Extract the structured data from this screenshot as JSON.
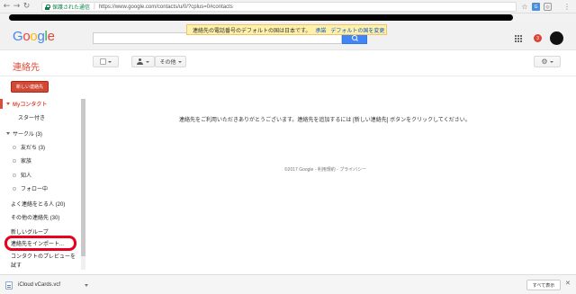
{
  "browser": {
    "back_icon": "←",
    "forward_icon": "→",
    "reload_icon": "↻",
    "secure_label": "保護された通信",
    "separator": "|",
    "url": "https://www.google.com/contacts/u/0/?cplus=0#contacts",
    "star_icon": "☆",
    "menu_icon": "⋮",
    "ext1_label": "G",
    "ext2_label": "◎"
  },
  "google_header": {
    "logo_letters": [
      "G",
      "o",
      "o",
      "g",
      "l",
      "e"
    ],
    "notice_text": "連絡先の電話番号のデフォルトの国は日本です。",
    "notice_ok_link": "承諾",
    "notice_change_link": "デフォルトの国を変更",
    "notification_count": "3"
  },
  "toolbar": {
    "app_title": "連絡先",
    "more_label": "その他",
    "settings_icon": "⚙"
  },
  "sidebar": {
    "new_contact_button": "新しい連絡先",
    "my_contacts": "Myコンタクト",
    "starred": "スター付き",
    "circles": "サークル (3)",
    "friends": "友だち (3)",
    "family": "家族",
    "acquaintances": "知人",
    "following": "フォロー中",
    "most_contacted": "よく連絡をとる人 (20)",
    "other_contacts": "その他の連絡先 (30)",
    "new_group": "新しいグループ",
    "import_contacts": "連絡先をインポート...",
    "preview_line1": "コンタクトのプレビューを",
    "preview_line2": "試す"
  },
  "main": {
    "empty_message": "連絡先をご利用いただきありがとうございます。連絡先を追加するには [新しい連絡先] ボタンをクリックしてください。",
    "footer_copyright": "©2017 Google - ",
    "footer_terms": "利用規約",
    "footer_sep": " - ",
    "footer_privacy": "プライバシー"
  },
  "download_bar": {
    "file_name": "iCloud vCards.vcf",
    "show_all_button": "すべて表示",
    "close_icon": "✕"
  },
  "colors": {
    "google_blue": "#4285f4",
    "contacts_red": "#dd4b39",
    "new_button_red": "#d14836",
    "highlight_red": "#e8001c",
    "notice_yellow": "#fff1a8",
    "secure_green": "#0b8043"
  }
}
